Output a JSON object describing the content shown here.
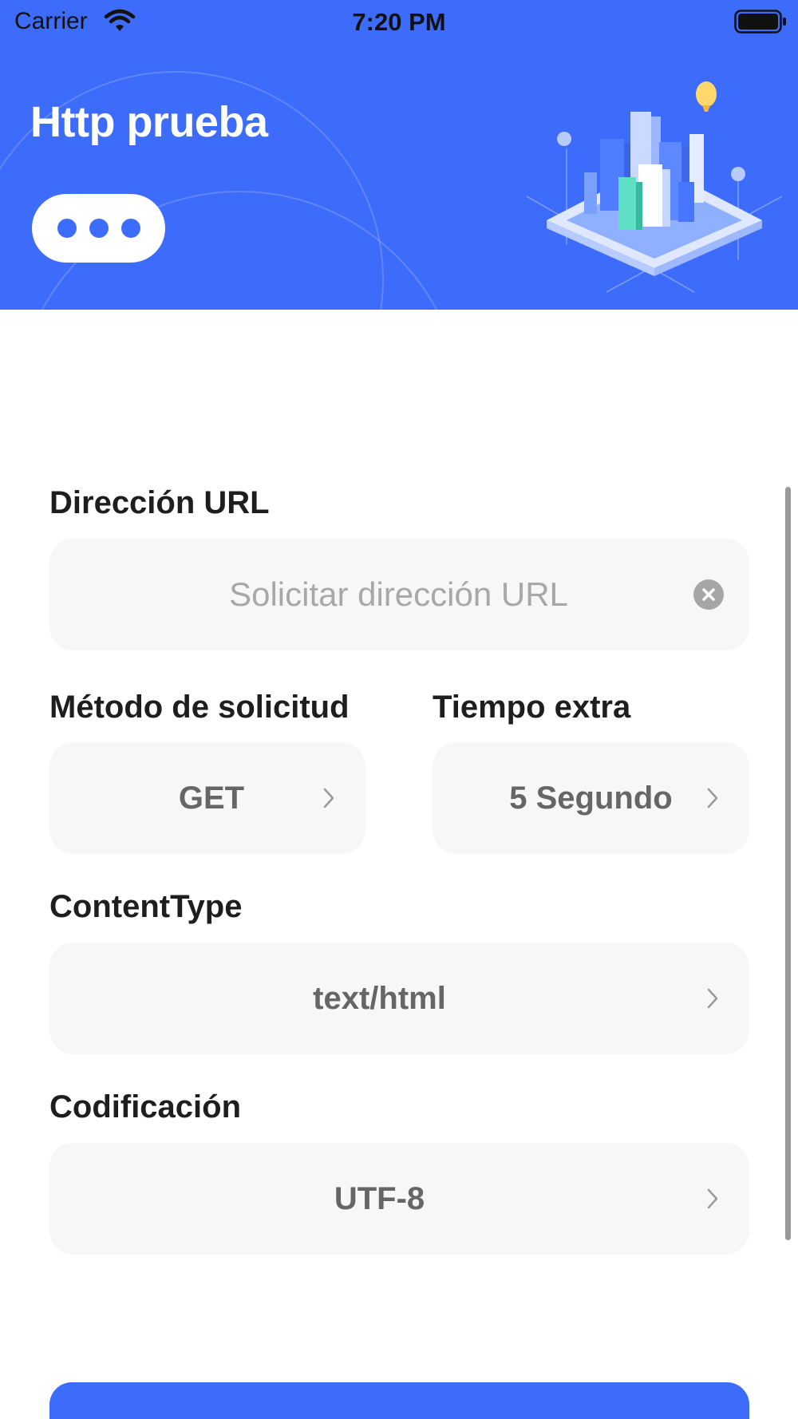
{
  "status_bar": {
    "carrier": "Carrier",
    "time": "7:20 PM",
    "wifi_icon": "wifi-icon",
    "battery_icon": "battery-full-icon"
  },
  "header": {
    "title": "Http prueba",
    "more_icon": "more-horizontal-icon",
    "illustration": "isometric-city-illustration"
  },
  "form": {
    "url": {
      "label": "Dirección URL",
      "value": "",
      "placeholder": "Solicitar dirección URL",
      "clear_icon": "clear-icon"
    },
    "method": {
      "label": "Método de solicitud",
      "value": "GET"
    },
    "timeout": {
      "label": "Tiempo extra",
      "value": "5 Segundo"
    },
    "content_type": {
      "label": "ContentType",
      "value": "text/html"
    },
    "encoding": {
      "label": "Codificación",
      "value": "UTF-8"
    }
  },
  "colors": {
    "primary": "#3d6cfb",
    "field_background": "#f7f7f7",
    "label_text": "#1e1e1e",
    "value_text": "#666666"
  }
}
